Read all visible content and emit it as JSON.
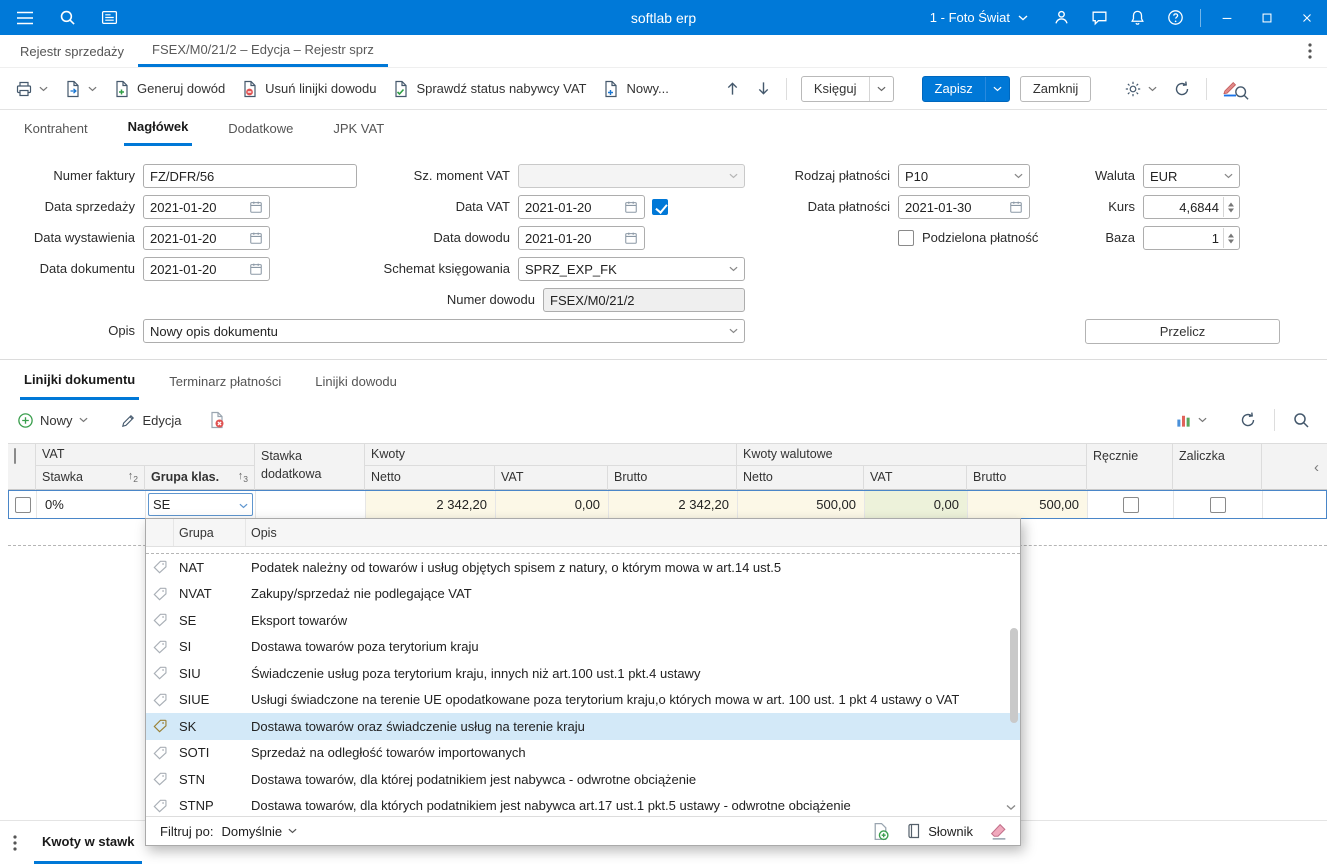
{
  "colors": {
    "accent": "#0078d7",
    "titlebar": "#0079d8",
    "row_highlight": "#fcf8e7",
    "row_highlight_green": "#edf2da",
    "dropdown_selection": "#d3e9f8"
  },
  "titlebar": {
    "title": "softlab erp",
    "company": "1 - Foto Świat"
  },
  "window_tabs": {
    "tab1": "Rejestr sprzedaży",
    "tab2": "FSEX/M0/21/2 – Edycja – Rejestr sprz"
  },
  "toolbar": {
    "generuj_dowod": "Generuj dowód",
    "usun_linijki_dowodu": "Usuń linijki dowodu",
    "sprawdz_status": "Sprawdź status nabywcy VAT",
    "nowy": "Nowy...",
    "ksieguj": "Księguj",
    "zapisz": "Zapisz",
    "zamknij": "Zamknij"
  },
  "header_tabs": {
    "kontrahent": "Kontrahent",
    "naglowek": "Nagłówek",
    "dodatkowe": "Dodatkowe",
    "jpk": "JPK VAT"
  },
  "form": {
    "numer_faktury_label": "Numer faktury",
    "numer_faktury_value": "FZ/DFR/56",
    "sz_moment_vat_label": "Sz. moment VAT",
    "sz_moment_vat_value": "",
    "rodzaj_platnosci_label": "Rodzaj płatności",
    "rodzaj_platnosci_value": "P10",
    "waluta_label": "Waluta",
    "waluta_value": "EUR",
    "data_sprzedazy_label": "Data sprzedaży",
    "data_sprzedazy_value": "2021-01-20",
    "data_vat_label": "Data VAT",
    "data_vat_value": "2021-01-20",
    "data_vat_checked": true,
    "data_platnosci_label": "Data płatności",
    "data_platnosci_value": "2021-01-30",
    "kurs_label": "Kurs",
    "kurs_value": "4,6844",
    "data_wystawienia_label": "Data wystawienia",
    "data_wystawienia_value": "2021-01-20",
    "data_dowodu_label": "Data dowodu",
    "data_dowodu_value": "2021-01-20",
    "podzielona_platnosc_label": "Podzielona płatność",
    "podzielona_platnosc_checked": false,
    "baza_label": "Baza",
    "baza_value": "1",
    "data_dokumentu_label": "Data dokumentu",
    "data_dokumentu_value": "2021-01-20",
    "schemat_ksiegowania_label": "Schemat księgowania",
    "schemat_ksiegowania_value": "SPRZ_EXP_FK",
    "numer_dowodu_label": "Numer dowodu",
    "numer_dowodu_value": "FSEX/M0/21/2",
    "opis_label": "Opis",
    "opis_value": "Nowy opis dokumentu",
    "przelicz": "Przelicz"
  },
  "section_tabs": {
    "linijki": "Linijki dokumentu",
    "terminarz": "Terminarz płatności",
    "dowod": "Linijki dowodu"
  },
  "lines_toolbar": {
    "nowy": "Nowy",
    "edycja": "Edycja"
  },
  "grid": {
    "groups": {
      "vat": "VAT",
      "stawka_dodatkowa": "Stawka dodatkowa",
      "kwoty": "Kwoty",
      "kwoty_walutowe": "Kwoty walutowe",
      "recznie": "Ręcznie",
      "zaliczka": "Zaliczka"
    },
    "cols": {
      "stawka": "Stawka",
      "grupa": "Grupa klas.",
      "netto": "Netto",
      "vat": "VAT",
      "brutto": "Brutto",
      "netto_wal": "Netto",
      "vat_wal": "VAT",
      "brutto_wal": "Brutto"
    },
    "sort": {
      "stawka": "2",
      "grupa": "3"
    },
    "row": {
      "stawka": "0%",
      "grupa": "SE",
      "stawka_dodatkowa": "",
      "netto": "2 342,20",
      "vat": "0,00",
      "brutto": "2 342,20",
      "netto_wal": "500,00",
      "vat_wal": "0,00",
      "brutto_wal": "500,00",
      "recznie_checked": false,
      "zaliczka_checked": false
    }
  },
  "dropdown": {
    "columns": {
      "grupa": "Grupa",
      "opis": "Opis"
    },
    "items": [
      {
        "grupa": "NAT",
        "opis": "Podatek należny od towarów i usług objętych spisem z natury, o którym mowa w art.14 ust.5"
      },
      {
        "grupa": "NVAT",
        "opis": "Zakupy/sprzedaż nie podlegające VAT"
      },
      {
        "grupa": "SE",
        "opis": "Eksport towarów"
      },
      {
        "grupa": "SI",
        "opis": "Dostawa towarów poza terytorium kraju"
      },
      {
        "grupa": "SIU",
        "opis": "Świadczenie usług poza terytorium kraju, innych niż art.100 ust.1 pkt.4 ustawy"
      },
      {
        "grupa": "SIUE",
        "opis": "Usługi świadczone na terenie UE opodatkowane poza terytorium kraju,o których mowa w art. 100 ust. 1 pkt 4 ustawy o VAT"
      },
      {
        "grupa": "SK",
        "opis": "Dostawa towarów oraz świadczenie usług na terenie kraju",
        "selected": true
      },
      {
        "grupa": "SOTI",
        "opis": "Sprzedaż na odległość towarów importowanych"
      },
      {
        "grupa": "STN",
        "opis": "Dostawa towarów, dla której podatnikiem jest nabywca - odwrotne obciążenie"
      },
      {
        "grupa": "STNP",
        "opis": "Dostawa towarów, dla których podatnikiem jest nabywca art.17 ust.1 pkt.5 ustawy - odwrotne obciążenie"
      }
    ],
    "footer": {
      "filtruj_po": "Filtruj po:",
      "domyslnie": "Domyślnie",
      "slownik": "Słownik"
    }
  },
  "bottom": {
    "tab": "Kwoty w stawk"
  }
}
